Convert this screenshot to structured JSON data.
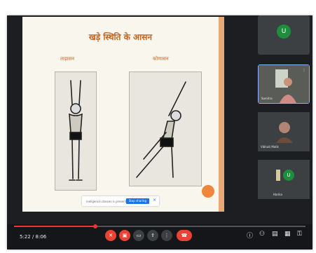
{
  "slide": {
    "title": "खड़े स्थिति के आसन",
    "pose_left_label": "ताड़ासन",
    "pose_right_label": "कोणासन"
  },
  "share_banner": {
    "text": "ineligence.classes is presenting",
    "button": "Stop sharing",
    "dismiss": "×"
  },
  "participants": [
    {
      "type": "avatar",
      "initial": "U",
      "name": "",
      "color": "#1e8e3e"
    },
    {
      "type": "video",
      "name": "Somitra",
      "active": true
    },
    {
      "type": "video",
      "name": "Vibhuti Malik",
      "active": false
    },
    {
      "type": "avatar",
      "initial": "U",
      "name": "Harika",
      "color": "#1e8e3e"
    }
  ],
  "player": {
    "time": "5:22 / 8:06",
    "progress": 0.28
  },
  "call_controls": [
    "mic-off",
    "camera-off",
    "captions",
    "present",
    "more",
    "end-call"
  ],
  "colors": {
    "accent_red": "#ea4335",
    "slide_title": "#c4641f",
    "avatar_green": "#1e8e3e",
    "active_border": "#8ab4f8"
  }
}
